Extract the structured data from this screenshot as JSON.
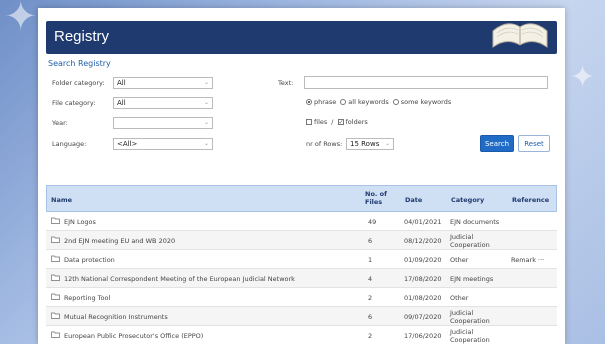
{
  "header": {
    "title": "Registry"
  },
  "search": {
    "title": "Search Registry",
    "folder_category_label": "Folder category:",
    "folder_category_value": "All",
    "file_category_label": "File category:",
    "file_category_value": "All",
    "year_label": "Year:",
    "year_value": "",
    "language_label": "Language:",
    "language_value": "<All>",
    "text_label": "Text:",
    "text_value": "",
    "match_options": [
      "phrase",
      "all keywords",
      "some keywords"
    ],
    "match_selected": "phrase",
    "files_label": "files",
    "folders_label": "folders",
    "folders_checked": true,
    "files_checked": false,
    "rows_label": "nr of Rows:",
    "rows_value": "15 Rows",
    "search_button": "Search",
    "reset_button": "Reset"
  },
  "table": {
    "columns": {
      "name": "Name",
      "files": "No. of Files",
      "date": "Date",
      "category": "Category",
      "reference": "Reference"
    },
    "rows": [
      {
        "name": "EJN Logos",
        "files": "49",
        "date": "04/01/2021",
        "category": "EJN documents",
        "reference": ""
      },
      {
        "name": "2nd EJN meeting EU and WB 2020",
        "files": "6",
        "date": "08/12/2020",
        "category": "Judicial Cooperation",
        "reference": ""
      },
      {
        "name": "Data protection",
        "files": "1",
        "date": "01/09/2020",
        "category": "Other",
        "reference": "Remark ···"
      },
      {
        "name": "12th National Correspondent Meeting of the European Judicial Network",
        "files": "4",
        "date": "17/08/2020",
        "category": "EJN meetings",
        "reference": ""
      },
      {
        "name": "Reporting Tool",
        "files": "2",
        "date": "01/08/2020",
        "category": "Other",
        "reference": ""
      },
      {
        "name": "Mutual Recognition Instruments",
        "files": "6",
        "date": "09/07/2020",
        "category": "Judicial Cooperation",
        "reference": ""
      },
      {
        "name": "European Public Prosecutor's Office (EPPO)",
        "files": "2",
        "date": "17/06/2020",
        "category": "Judicial Cooperation",
        "reference": ""
      }
    ]
  }
}
